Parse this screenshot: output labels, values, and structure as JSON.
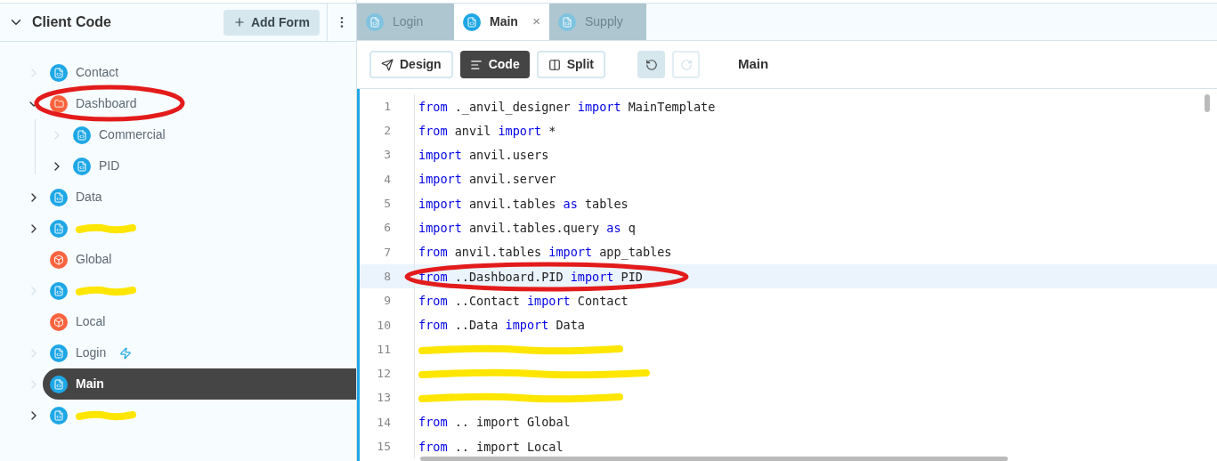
{
  "sidebar": {
    "title": "Client Code",
    "expanded": true,
    "add_button": "Add Form",
    "items": [
      {
        "kind": "form",
        "label": "Contact",
        "expandable": false,
        "expanded": false,
        "selected": false,
        "circled": false,
        "redacted": false,
        "startup": false
      },
      {
        "kind": "folder",
        "label": "Dashboard",
        "expandable": true,
        "expanded": true,
        "selected": false,
        "circled": true,
        "redacted": false,
        "startup": false,
        "children": [
          {
            "kind": "form",
            "label": "Commercial",
            "expandable": false,
            "expanded": false,
            "selected": false,
            "circled": false,
            "redacted": false,
            "startup": false
          },
          {
            "kind": "form",
            "label": "PID",
            "expandable": true,
            "expanded": false,
            "selected": false,
            "circled": false,
            "redacted": false,
            "startup": false
          }
        ]
      },
      {
        "kind": "form",
        "label": "Data",
        "expandable": true,
        "expanded": false,
        "selected": false,
        "circled": false,
        "redacted": false,
        "startup": false
      },
      {
        "kind": "form",
        "expandable": true,
        "expanded": false,
        "selected": false,
        "circled": false,
        "redacted": true,
        "startup": false
      },
      {
        "kind": "module",
        "label": "Global",
        "selected": false,
        "circled": false,
        "redacted": false,
        "startup": false
      },
      {
        "kind": "form",
        "expandable": false,
        "expanded": false,
        "selected": false,
        "circled": false,
        "redacted": true,
        "startup": false
      },
      {
        "kind": "module",
        "label": "Local",
        "selected": false,
        "circled": false,
        "redacted": false,
        "startup": false
      },
      {
        "kind": "form",
        "label": "Login",
        "expandable": false,
        "expanded": false,
        "selected": false,
        "circled": false,
        "redacted": false,
        "startup": true
      },
      {
        "kind": "form",
        "label": "Main",
        "expandable": false,
        "expanded": false,
        "selected": true,
        "circled": false,
        "redacted": false,
        "startup": false
      },
      {
        "kind": "form",
        "expandable": true,
        "expanded": false,
        "selected": false,
        "circled": false,
        "redacted": true,
        "startup": false
      }
    ]
  },
  "tabs": [
    {
      "label": "Login",
      "selected": false
    },
    {
      "label": "Main",
      "selected": true,
      "close": "×"
    },
    {
      "label": "Supply",
      "selected": false
    }
  ],
  "toolbar": {
    "modes": [
      {
        "label": "Design",
        "kind": "design",
        "selected": false
      },
      {
        "label": "Code",
        "kind": "code",
        "selected": true
      },
      {
        "label": "Split",
        "kind": "split",
        "selected": false
      }
    ],
    "undo_disabled": false,
    "redo_disabled": true,
    "title": "Main"
  },
  "code": [
    {
      "number": "1",
      "highlighted": false,
      "circled": false,
      "redacted": false,
      "tokens": [
        {
          "kind": "kw",
          "text": "from"
        },
        {
          "kind": "plain",
          "text": " ._anvil_designer "
        },
        {
          "kind": "kw",
          "text": "import"
        },
        {
          "kind": "plain",
          "text": " MainTemplate"
        }
      ]
    },
    {
      "number": "2",
      "highlighted": false,
      "circled": false,
      "redacted": false,
      "tokens": [
        {
          "kind": "kw",
          "text": "from"
        },
        {
          "kind": "plain",
          "text": " anvil "
        },
        {
          "kind": "kw",
          "text": "import"
        },
        {
          "kind": "plain",
          "text": " *"
        }
      ]
    },
    {
      "number": "3",
      "highlighted": false,
      "circled": false,
      "redacted": false,
      "tokens": [
        {
          "kind": "kw",
          "text": "import"
        },
        {
          "kind": "plain",
          "text": " anvil.users"
        }
      ]
    },
    {
      "number": "4",
      "highlighted": false,
      "circled": false,
      "redacted": false,
      "tokens": [
        {
          "kind": "kw",
          "text": "import"
        },
        {
          "kind": "plain",
          "text": " anvil.server"
        }
      ]
    },
    {
      "number": "5",
      "highlighted": false,
      "circled": false,
      "redacted": false,
      "tokens": [
        {
          "kind": "kw",
          "text": "import"
        },
        {
          "kind": "plain",
          "text": " anvil.tables "
        },
        {
          "kind": "kw",
          "text": "as"
        },
        {
          "kind": "plain",
          "text": " tables"
        }
      ]
    },
    {
      "number": "6",
      "highlighted": false,
      "circled": false,
      "redacted": false,
      "tokens": [
        {
          "kind": "kw",
          "text": "import"
        },
        {
          "kind": "plain",
          "text": " anvil.tables.query "
        },
        {
          "kind": "kw",
          "text": "as"
        },
        {
          "kind": "plain",
          "text": " q"
        }
      ]
    },
    {
      "number": "7",
      "highlighted": false,
      "circled": false,
      "redacted": false,
      "tokens": [
        {
          "kind": "kw",
          "text": "from"
        },
        {
          "kind": "plain",
          "text": " anvil.tables "
        },
        {
          "kind": "kw",
          "text": "import"
        },
        {
          "kind": "plain",
          "text": " app_tables"
        }
      ]
    },
    {
      "number": "8",
      "highlighted": true,
      "circled": true,
      "redacted": false,
      "tokens": [
        {
          "kind": "kw",
          "text": "from"
        },
        {
          "kind": "plain",
          "text": " ..Dashboard.PID "
        },
        {
          "kind": "kw",
          "text": "import"
        },
        {
          "kind": "plain",
          "text": " PID"
        }
      ]
    },
    {
      "number": "9",
      "highlighted": false,
      "circled": false,
      "redacted": false,
      "tokens": [
        {
          "kind": "kw",
          "text": "from"
        },
        {
          "kind": "plain",
          "text": " ..Contact "
        },
        {
          "kind": "kw",
          "text": "import"
        },
        {
          "kind": "plain",
          "text": " Contact"
        }
      ]
    },
    {
      "number": "10",
      "highlighted": false,
      "circled": false,
      "redacted": false,
      "tokens": [
        {
          "kind": "kw",
          "text": "from"
        },
        {
          "kind": "plain",
          "text": " ..Data "
        },
        {
          "kind": "kw",
          "text": "import"
        },
        {
          "kind": "plain",
          "text": " Data"
        }
      ]
    },
    {
      "number": "11",
      "highlighted": false,
      "circled": false,
      "redacted": true
    },
    {
      "number": "12",
      "highlighted": false,
      "circled": false,
      "redacted": true
    },
    {
      "number": "13",
      "highlighted": false,
      "circled": false,
      "redacted": true
    },
    {
      "number": "14",
      "highlighted": false,
      "circled": false,
      "redacted": false,
      "tokens": [
        {
          "kind": "kw",
          "text": "from"
        },
        {
          "kind": "plain",
          "text": " .. "
        },
        {
          "kind": "plain",
          "text": "import"
        },
        {
          "kind": "plain",
          "text": " Global"
        }
      ]
    },
    {
      "number": "15",
      "highlighted": false,
      "circled": false,
      "redacted": false,
      "tokens": [
        {
          "kind": "kw",
          "text": "from"
        },
        {
          "kind": "plain",
          "text": " .. "
        },
        {
          "kind": "plain",
          "text": "import"
        },
        {
          "kind": "plain",
          "text": " Local"
        }
      ]
    }
  ]
}
